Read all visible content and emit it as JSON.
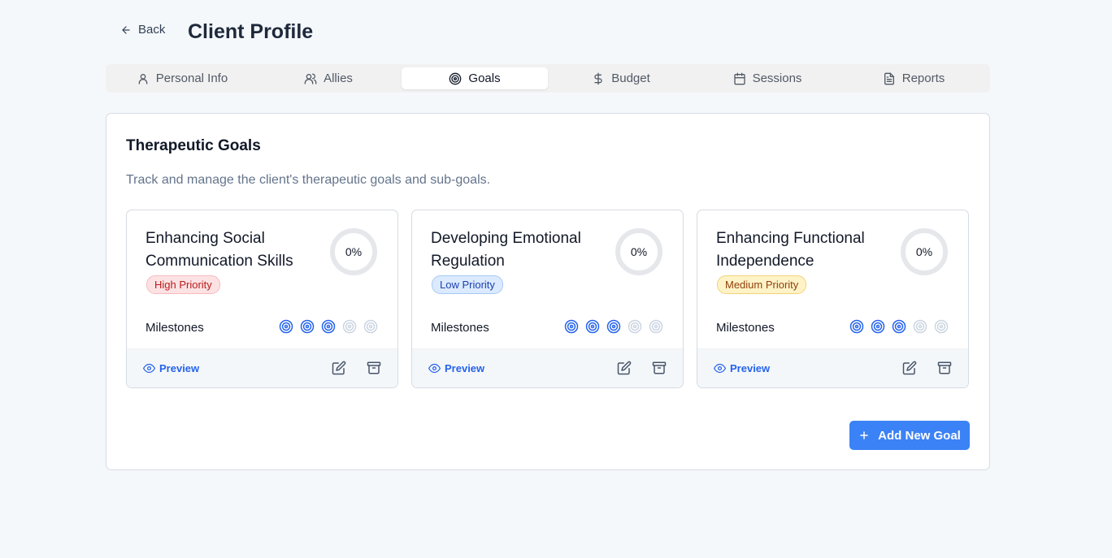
{
  "header": {
    "back_label": "Back",
    "title": "Client Profile"
  },
  "tabs": [
    {
      "label": "Personal Info",
      "icon": "user-icon"
    },
    {
      "label": "Allies",
      "icon": "users-icon"
    },
    {
      "label": "Goals",
      "icon": "target-icon"
    },
    {
      "label": "Budget",
      "icon": "dollar-icon"
    },
    {
      "label": "Sessions",
      "icon": "calendar-icon"
    },
    {
      "label": "Reports",
      "icon": "file-text-icon"
    }
  ],
  "active_tab": "Goals",
  "panel": {
    "title": "Therapeutic Goals",
    "description": "Track and manage the client's therapeutic goals and sub-goals."
  },
  "goals": [
    {
      "title": "Enhancing Social Communication Skills",
      "priority": "High Priority",
      "progress": "0%",
      "milestones_label": "Milestones",
      "milestones_completed": 3,
      "milestones_total": 5,
      "preview_label": "Preview"
    },
    {
      "title": "Developing Emotional Regulation",
      "priority": "Low Priority",
      "progress": "0%",
      "milestones_label": "Milestones",
      "milestones_completed": 3,
      "milestones_total": 5,
      "preview_label": "Preview"
    },
    {
      "title": "Enhancing Functional Independence",
      "priority": "Medium Priority",
      "progress": "0%",
      "milestones_label": "Milestones",
      "milestones_completed": 3,
      "milestones_total": 5,
      "preview_label": "Preview"
    }
  ],
  "add_goal_label": "Add New Goal",
  "colors": {
    "accent": "#3b82f6",
    "milestone_done": "#2563eb",
    "milestone_pending": "#cbd5e1",
    "high_priority": "#b91c1c",
    "low_priority": "#1e40af",
    "medium_priority": "#92400e"
  }
}
